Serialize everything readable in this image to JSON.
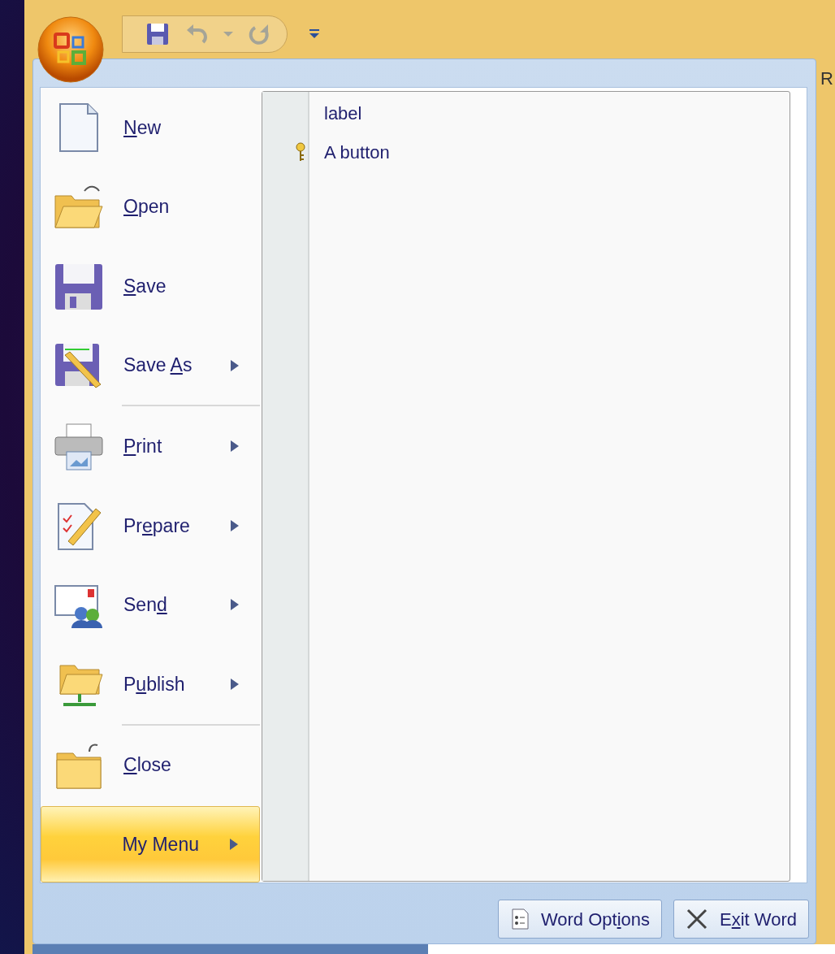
{
  "quick_access_toolbar": [
    {
      "kind": "save",
      "disabled": false
    },
    {
      "kind": "undo",
      "disabled": true
    },
    {
      "kind": "dropdown",
      "disabled": true
    },
    {
      "kind": "redo",
      "disabled": true
    },
    {
      "kind": "customize",
      "disabled": false
    }
  ],
  "ribbon_fragment": "R",
  "office_menu": {
    "commands": [
      {
        "kind": "command",
        "label_key": "N",
        "label_after": "ew",
        "submenu": false,
        "selected": false
      },
      {
        "kind": "command",
        "label_key": "O",
        "label_after": "pen",
        "submenu": false,
        "selected": false
      },
      {
        "kind": "command",
        "label_key": "S",
        "label_after": "ave",
        "submenu": false,
        "selected": false
      },
      {
        "kind": "command",
        "label_before": "Save ",
        "label_key": "A",
        "label_after": "s",
        "submenu": true,
        "selected": false
      },
      {
        "kind": "separator"
      },
      {
        "kind": "command",
        "label_key": "P",
        "label_after": "rint",
        "submenu": true,
        "selected": false
      },
      {
        "kind": "command",
        "label_before": "Pr",
        "label_key": "e",
        "label_after": "pare",
        "submenu": true,
        "selected": false
      },
      {
        "kind": "command",
        "label_before": "Sen",
        "label_key": "d",
        "submenu": true,
        "selected": false
      },
      {
        "kind": "command",
        "label_before": "P",
        "label_key": "u",
        "label_after": "blish",
        "submenu": true,
        "selected": false
      },
      {
        "kind": "separator"
      },
      {
        "kind": "command",
        "label_key": "C",
        "label_after": "lose",
        "submenu": false,
        "selected": false
      },
      {
        "kind": "command",
        "label_before": "My Menu",
        "submenu": true,
        "selected": true
      }
    ],
    "submenu_items": [
      {
        "kind": "label",
        "label": "label"
      },
      {
        "kind": "button",
        "label": "A button"
      }
    ],
    "footer_buttons": [
      {
        "kind": "options",
        "label_before": "Word Opt",
        "label_key": "i",
        "label_after": "ons"
      },
      {
        "kind": "exit",
        "label_before": "E",
        "label_key": "x",
        "label_after": "it Word"
      }
    ]
  }
}
